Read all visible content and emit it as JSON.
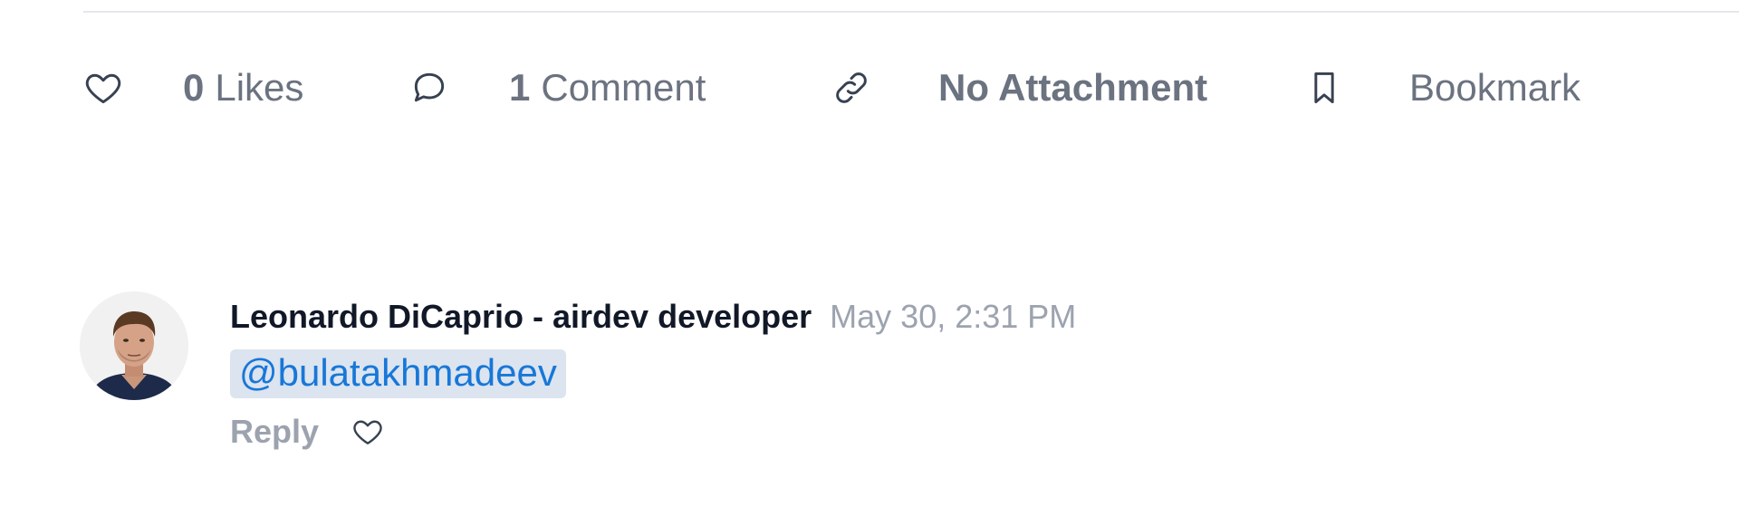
{
  "actions": {
    "likes": {
      "count": "0",
      "label": "Likes",
      "icon": "heart-icon"
    },
    "comments": {
      "count": "1",
      "label": "Comment",
      "icon": "comment-icon"
    },
    "attachment": {
      "label": "No Attachment",
      "icon": "link-icon"
    },
    "bookmark": {
      "label": "Bookmark",
      "icon": "bookmark-icon"
    }
  },
  "comment": {
    "author": "Leonardo DiCaprio - airdev developer",
    "timestamp": "May 30, 2:31 PM",
    "mention": "@bulatakhmadeev",
    "reply_label": "Reply",
    "like_icon": "heart-icon"
  },
  "colors": {
    "text_muted": "#6b7280",
    "text_dark": "#111827",
    "timestamp": "#9ca3af",
    "mention_text": "#1877d8",
    "mention_bg": "#dbe4ef",
    "divider": "#e5e7eb"
  }
}
